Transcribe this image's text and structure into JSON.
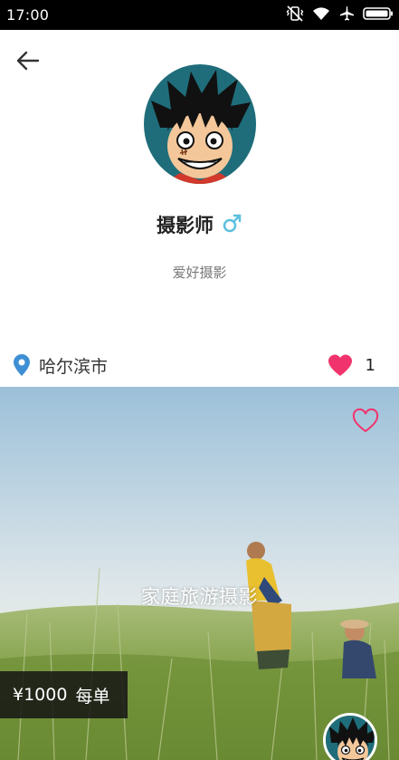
{
  "status_bar": {
    "time": "17:00",
    "icons": [
      "vibrate-icon",
      "wifi-icon",
      "airplane-icon",
      "battery-icon"
    ]
  },
  "profile": {
    "name": "摄影师",
    "gender_symbol": "♂",
    "bio": "爱好摄影",
    "location": "哈尔滨市",
    "like_count": "1"
  },
  "card": {
    "title": "家庭旅游摄影",
    "price": "¥1000",
    "price_unit": "每单"
  },
  "colors": {
    "heart": "#f0336c",
    "location_pin": "#3f8fd4",
    "gender": "#5bc0de",
    "avatar_bg": "#1f6d7a"
  }
}
